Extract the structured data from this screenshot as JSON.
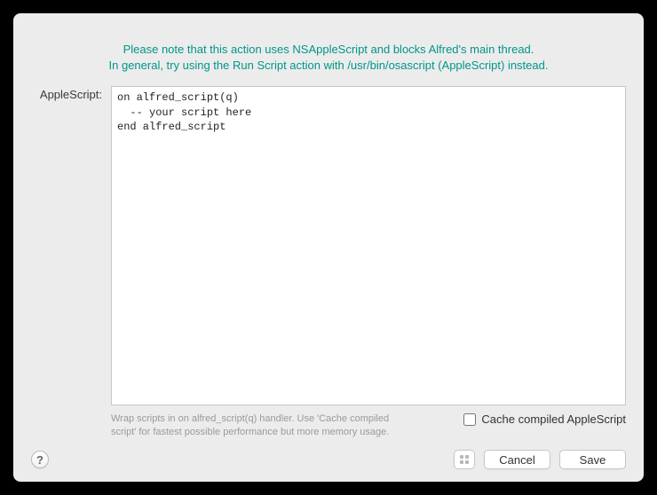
{
  "notice": {
    "line1": "Please note that this action uses NSAppleScript and blocks Alfred's main thread.",
    "line2": "In general, try using the Run Script action with /usr/bin/osascript (AppleScript) instead."
  },
  "form": {
    "label": "AppleScript:"
  },
  "editor": {
    "content": "on alfred_script(q)\n  -- your script here\nend alfred_script"
  },
  "hint": "Wrap scripts in on alfred_script(q) handler. Use 'Cache compiled script' for fastest possible performance but more memory usage.",
  "cache_checkbox": {
    "label": "Cache compiled AppleScript"
  },
  "buttons": {
    "help": "?",
    "cancel": "Cancel",
    "save": "Save"
  }
}
